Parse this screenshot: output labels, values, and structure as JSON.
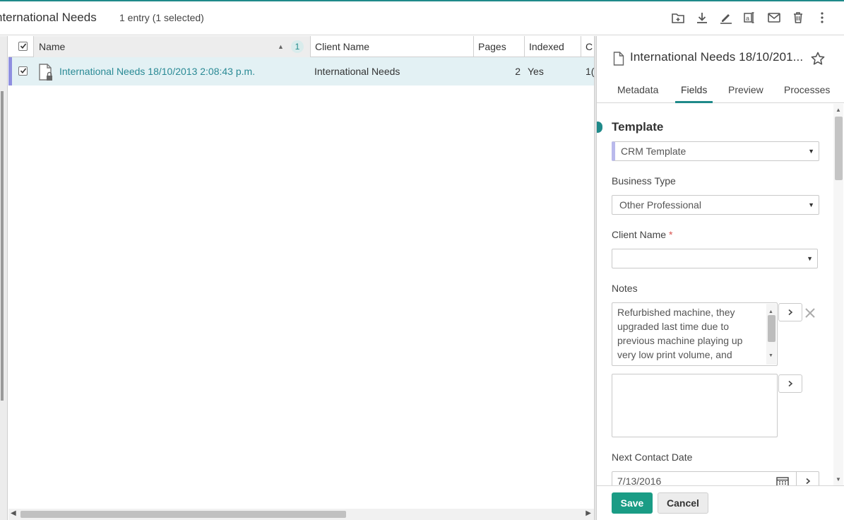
{
  "header": {
    "title": "nternational Needs",
    "entry_count": "1 entry (1 selected)"
  },
  "toolbar": {
    "icons": [
      "new-folder-icon",
      "download-icon",
      "sign-icon",
      "ocr-text-icon",
      "email-icon",
      "delete-icon",
      "more-vertical-icon"
    ]
  },
  "grid": {
    "columns": {
      "name": "Name",
      "sort_order": "1",
      "client_name": "Client Name",
      "pages": "Pages",
      "indexed": "Indexed",
      "next": "C"
    },
    "rows": [
      {
        "name": "International Needs 18/10/2013 2:08:43 p.m.",
        "client_name": "International Needs",
        "pages": "2",
        "indexed": "Yes",
        "next": "1("
      }
    ]
  },
  "panel": {
    "title": "International Needs 18/10/201...",
    "tabs": [
      "Metadata",
      "Fields",
      "Preview",
      "Processes"
    ],
    "active_tab": "Fields",
    "template_label": "Template",
    "template_value": "CRM Template",
    "business_type_label": "Business Type",
    "business_type_value": "Other Professional",
    "client_name_label": "Client Name",
    "required_mark": "*",
    "client_name_value": "",
    "notes_label": "Notes",
    "notes_value": "Refurbished machine, they upgraded last time due to previous machine playing up very low print volume, and",
    "notes_second_value": "",
    "next_contact_label": "Next Contact Date",
    "next_contact_value": "7/13/2016",
    "save_label": "Save",
    "cancel_label": "Cancel"
  },
  "colors": {
    "accent": "#1f8a8a",
    "save_button": "#1a9c85",
    "selected_row": "#e3f1f4",
    "link_text": "#2a8a95"
  }
}
